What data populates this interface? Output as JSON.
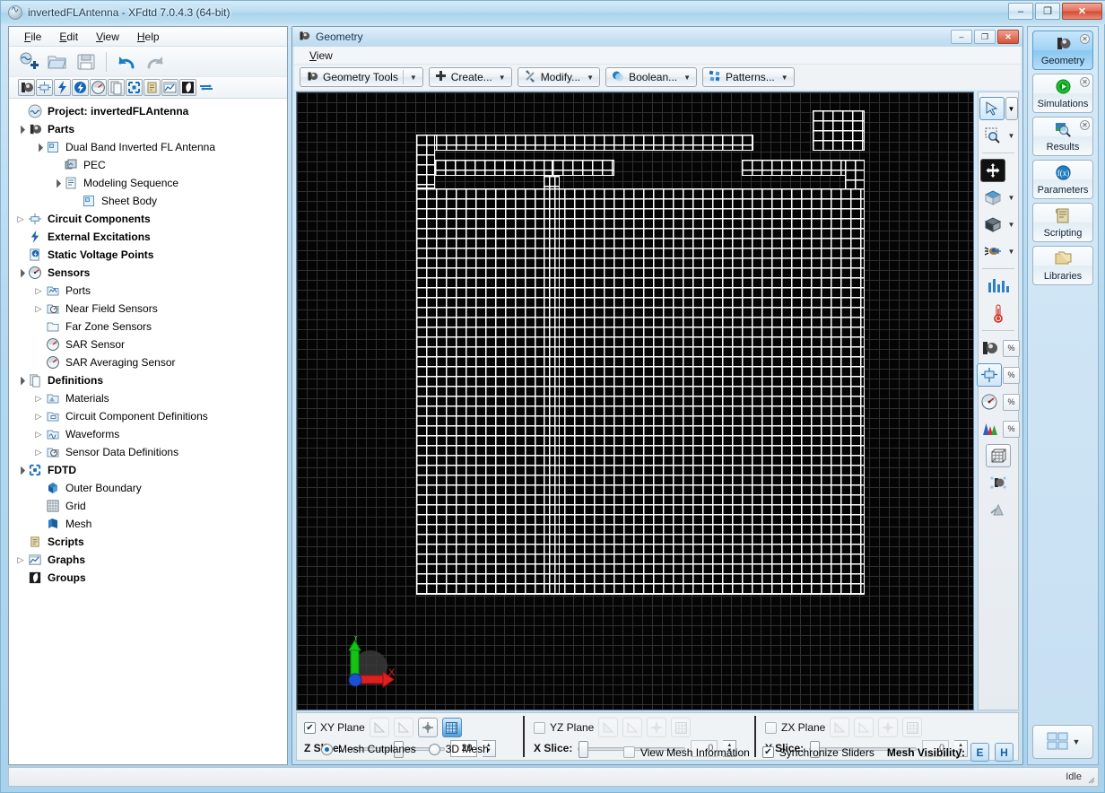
{
  "window": {
    "title": "invertedFLAntenna - XFdtd 7.0.4.3 (64-bit)",
    "app_icon": "waveform-icon",
    "minimize": "–",
    "maximize": "❐",
    "close": "✕"
  },
  "menubar": {
    "items": [
      {
        "label": "File",
        "mnemonic": "F"
      },
      {
        "label": "Edit",
        "mnemonic": "E"
      },
      {
        "label": "View",
        "mnemonic": "V"
      },
      {
        "label": "Help",
        "mnemonic": "H"
      }
    ]
  },
  "main_toolbar": {
    "buttons": [
      {
        "name": "new-project-icon",
        "title": "New Project"
      },
      {
        "name": "open-project-icon",
        "title": "Open Project"
      },
      {
        "name": "save-project-icon",
        "title": "Save Project"
      },
      {
        "name": "undo-icon",
        "title": "Undo"
      },
      {
        "name": "redo-icon",
        "title": "Redo"
      }
    ]
  },
  "nav_toolbar": {
    "buttons": [
      {
        "name": "parts-icon",
        "title": "Parts"
      },
      {
        "name": "circuit-components-icon",
        "title": "Circuit Components"
      },
      {
        "name": "external-excitations-icon",
        "title": "External Excitations"
      },
      {
        "name": "static-voltage-points-icon",
        "title": "Static Voltage Points"
      },
      {
        "name": "sensors-icon",
        "title": "Sensors"
      },
      {
        "name": "definitions-icon",
        "title": "Definitions"
      },
      {
        "name": "fdtd-icon",
        "title": "FDTD"
      },
      {
        "name": "scripts-icon",
        "title": "Scripts"
      },
      {
        "name": "graphs-icon",
        "title": "Graphs"
      },
      {
        "name": "groups-icon",
        "title": "Groups"
      },
      {
        "name": "refresh-icon",
        "title": "Refresh"
      }
    ]
  },
  "tree": {
    "nodes": [
      {
        "label": "Project: invertedFLAntenna",
        "indent": 0,
        "twist": "",
        "bold": true,
        "icon": "project-icon"
      },
      {
        "label": "Parts",
        "indent": 0,
        "twist": "expanded",
        "bold": true,
        "icon": "parts-icon"
      },
      {
        "label": "Dual Band Inverted FL Antenna",
        "indent": 1,
        "twist": "expanded",
        "bold": false,
        "icon": "sheet-icon"
      },
      {
        "label": "PEC",
        "indent": 2,
        "twist": "",
        "bold": false,
        "icon": "material-icon"
      },
      {
        "label": "Modeling Sequence",
        "indent": 2,
        "twist": "expanded",
        "bold": false,
        "icon": "sequence-icon"
      },
      {
        "label": "Sheet Body",
        "indent": 3,
        "twist": "",
        "bold": false,
        "icon": "sheet-icon"
      },
      {
        "label": "Circuit Components",
        "indent": 0,
        "twist": "collapsed",
        "bold": true,
        "icon": "circuit-components-icon"
      },
      {
        "label": "External Excitations",
        "indent": 0,
        "twist": "",
        "bold": true,
        "icon": "external-excitations-icon"
      },
      {
        "label": "Static Voltage Points",
        "indent": 0,
        "twist": "",
        "bold": true,
        "icon": "static-voltage-points-icon"
      },
      {
        "label": "Sensors",
        "indent": 0,
        "twist": "expanded",
        "bold": true,
        "icon": "sensors-icon"
      },
      {
        "label": "Ports",
        "indent": 1,
        "twist": "collapsed",
        "bold": false,
        "icon": "ports-icon"
      },
      {
        "label": "Near Field Sensors",
        "indent": 1,
        "twist": "collapsed",
        "bold": false,
        "icon": "near-field-sensors-icon"
      },
      {
        "label": "Far Zone Sensors",
        "indent": 1,
        "twist": "",
        "bold": false,
        "icon": "far-zone-sensors-icon"
      },
      {
        "label": "SAR Sensor",
        "indent": 1,
        "twist": "",
        "bold": false,
        "icon": "sar-sensor-icon"
      },
      {
        "label": "SAR Averaging Sensor",
        "indent": 1,
        "twist": "",
        "bold": false,
        "icon": "sar-averaging-sensor-icon"
      },
      {
        "label": "Definitions",
        "indent": 0,
        "twist": "expanded",
        "bold": true,
        "icon": "definitions-icon"
      },
      {
        "label": "Materials",
        "indent": 1,
        "twist": "collapsed",
        "bold": false,
        "icon": "materials-icon"
      },
      {
        "label": "Circuit Component Definitions",
        "indent": 1,
        "twist": "collapsed",
        "bold": false,
        "icon": "circuit-component-definitions-icon"
      },
      {
        "label": "Waveforms",
        "indent": 1,
        "twist": "collapsed",
        "bold": false,
        "icon": "waveforms-icon"
      },
      {
        "label": "Sensor Data Definitions",
        "indent": 1,
        "twist": "collapsed",
        "bold": false,
        "icon": "sensor-data-definitions-icon"
      },
      {
        "label": "FDTD",
        "indent": 0,
        "twist": "expanded",
        "bold": true,
        "icon": "fdtd-icon"
      },
      {
        "label": "Outer Boundary",
        "indent": 1,
        "twist": "",
        "bold": false,
        "icon": "outer-boundary-icon"
      },
      {
        "label": "Grid",
        "indent": 1,
        "twist": "",
        "bold": false,
        "icon": "grid-icon"
      },
      {
        "label": "Mesh",
        "indent": 1,
        "twist": "",
        "bold": false,
        "icon": "mesh-icon"
      },
      {
        "label": "Scripts",
        "indent": 0,
        "twist": "",
        "bold": true,
        "icon": "scripts-icon"
      },
      {
        "label": "Graphs",
        "indent": 0,
        "twist": "collapsed",
        "bold": true,
        "icon": "graphs-icon"
      },
      {
        "label": "Groups",
        "indent": 0,
        "twist": "",
        "bold": true,
        "icon": "groups-icon"
      }
    ]
  },
  "geometry_window": {
    "title": "Geometry",
    "icon": "geometry-icon",
    "minimize": "–",
    "restore": "❐",
    "close": "✕",
    "menu": [
      {
        "label": "View",
        "mnemonic": "V"
      }
    ],
    "toolbar": [
      {
        "label": "Geometry Tools",
        "icon": "geometry-icon",
        "caret": "▼",
        "split": true
      },
      {
        "label": "Create...",
        "icon": "plus-icon",
        "caret": "▼",
        "split": false
      },
      {
        "label": "Modify...",
        "icon": "wrench-icon",
        "caret": "▼",
        "split": false
      },
      {
        "label": "Boolean...",
        "icon": "boolean-icon",
        "caret": "▼",
        "split": false
      },
      {
        "label": "Patterns...",
        "icon": "patterns-icon",
        "caret": "▼",
        "split": false
      }
    ],
    "axis_indicator": {
      "x_label": "X",
      "x_color": "#e02020",
      "y_label": "Y",
      "y_color": "#22d022",
      "origin_color": "#1a4fd6"
    },
    "canvas": {
      "background": "#050505",
      "bg_grid_color": "#303030",
      "mesh_color": "#ffffff"
    }
  },
  "view_toolstrip": {
    "buttons": [
      {
        "name": "select-arrow-icon",
        "caret": true,
        "selected": true
      },
      {
        "name": "zoom-region-icon",
        "caret": true,
        "selected": false
      },
      {
        "name": "pan-move-icon",
        "caret": false,
        "selected": false
      },
      {
        "name": "view-direction-cube-icon",
        "caret": true,
        "selected": false
      },
      {
        "name": "view-shading-cube-icon",
        "caret": true,
        "selected": false
      },
      {
        "name": "lighting-icon",
        "caret": true,
        "selected": false
      },
      {
        "name": "bar-chart-icon",
        "caret": false,
        "selected": false
      },
      {
        "name": "thermometer-icon",
        "caret": false,
        "selected": false
      },
      {
        "name": "geometry-visibility-icon",
        "pct": "%",
        "selected": false
      },
      {
        "name": "sheet-visibility-icon",
        "pct": "%",
        "selected": true
      },
      {
        "name": "sensors-visibility-icon",
        "pct": "%",
        "selected": false
      },
      {
        "name": "materials-visibility-icon",
        "pct": "%",
        "selected": false
      },
      {
        "name": "grid-cube-icon",
        "caret": false,
        "selected": false
      },
      {
        "name": "mesh-particles-icon",
        "caret": false,
        "selected": false
      },
      {
        "name": "mesh-field-icon",
        "caret": false,
        "selected": false
      }
    ],
    "pct_label": "%"
  },
  "cutplane_panel": {
    "planes": [
      {
        "id": "xy",
        "label": "XY Plane",
        "checked": true,
        "buttons": [
          {
            "name": "cutplane-hide-icon",
            "enabled": false,
            "active": false
          },
          {
            "name": "cutplane-outline-icon",
            "enabled": false,
            "active": false
          },
          {
            "name": "cutplane-center-icon",
            "enabled": true,
            "active": false
          },
          {
            "name": "cutplane-grid-icon",
            "enabled": true,
            "active": true
          }
        ],
        "slice_label": "Z Slice:",
        "slice_value": "20",
        "slice_pos_pct": 47,
        "slice_enabled": true
      },
      {
        "id": "yz",
        "label": "YZ Plane",
        "checked": false,
        "buttons": [
          {
            "name": "cutplane-hide-icon",
            "enabled": false,
            "active": false
          },
          {
            "name": "cutplane-outline-icon",
            "enabled": false,
            "active": false
          },
          {
            "name": "cutplane-center-icon",
            "enabled": false,
            "active": false
          },
          {
            "name": "cutplane-grid-icon",
            "enabled": false,
            "active": false
          }
        ],
        "slice_label": "X Slice:",
        "slice_value": "0",
        "slice_pos_pct": 0,
        "slice_enabled": false
      },
      {
        "id": "zx",
        "label": "ZX Plane",
        "checked": false,
        "buttons": [
          {
            "name": "cutplane-hide-icon",
            "enabled": false,
            "active": false
          },
          {
            "name": "cutplane-outline-icon",
            "enabled": false,
            "active": false
          },
          {
            "name": "cutplane-center-icon",
            "enabled": false,
            "active": false
          },
          {
            "name": "cutplane-grid-icon",
            "enabled": false,
            "active": false
          }
        ],
        "slice_label": "Y Slice:",
        "slice_value": "0",
        "slice_pos_pct": 0,
        "slice_enabled": false
      }
    ],
    "mode": {
      "mesh_cutplanes_label": "Mesh Cutplanes",
      "mesh_cutplanes_selected": true,
      "three_d_mesh_label": "3D Mesh",
      "three_d_mesh_selected": false
    },
    "view_mesh_information_label": "View Mesh Information",
    "view_mesh_information_checked": false,
    "synchronize_sliders_label": "Synchronize Sliders",
    "synchronize_sliders_checked": true,
    "mesh_visibility_label": "Mesh Visibility:",
    "mesh_visibility_e": "E",
    "mesh_visibility_h": "H",
    "spin_up": "▲",
    "spin_down": "▼"
  },
  "right_dock": {
    "tabs": [
      {
        "label": "Geometry",
        "icon": "geometry-icon",
        "active": true,
        "closable": true
      },
      {
        "label": "Simulations",
        "icon": "simulations-play-icon",
        "active": false,
        "closable": true
      },
      {
        "label": "Results",
        "icon": "results-magnifier-icon",
        "active": false,
        "closable": true
      },
      {
        "label": "Parameters",
        "icon": "parameters-fx-icon",
        "active": false,
        "closable": false
      },
      {
        "label": "Scripting",
        "icon": "scripting-scroll-icon",
        "active": false,
        "closable": false
      },
      {
        "label": "Libraries",
        "icon": "libraries-folders-icon",
        "active": false,
        "closable": false
      }
    ],
    "bottom_button": {
      "name": "window-layout-icon",
      "caret": "▼"
    },
    "close_glyph": "✕"
  },
  "statusbar": {
    "text": "Idle"
  },
  "colors": {
    "accent": "#1668b0",
    "mesh": "#ffffff",
    "canvas_bg": "#050505",
    "title_text": "#1b3a52",
    "axis_x": "#e02020",
    "axis_y": "#22d022"
  }
}
